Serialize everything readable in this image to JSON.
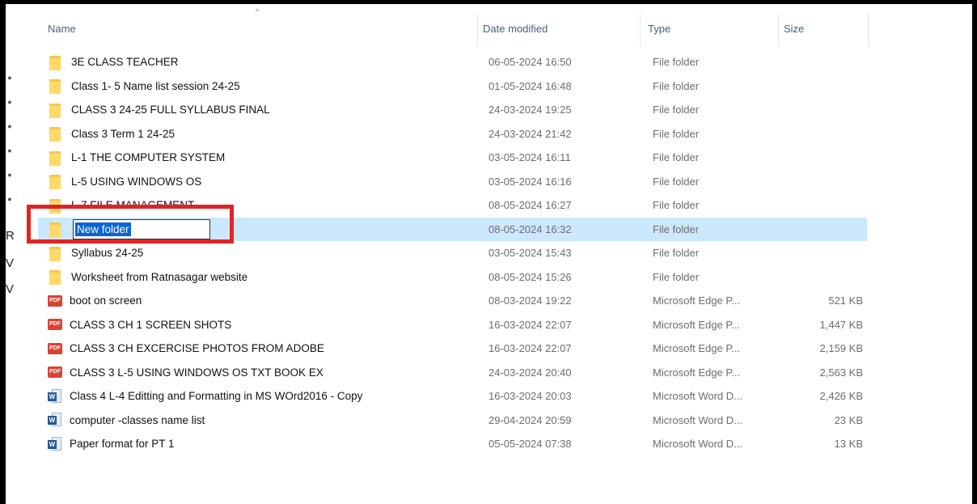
{
  "columns": {
    "name": "Name",
    "date": "Date modified",
    "type": "Type",
    "size": "Size"
  },
  "nav_letters": [
    "R",
    "V",
    "V"
  ],
  "rows": [
    {
      "name": "3E CLASS TEACHER",
      "date": "06-05-2024 16:50",
      "type": "File folder",
      "size": "",
      "icon": "folder-icon"
    },
    {
      "name": "Class 1- 5 Name list session 24-25",
      "date": "01-05-2024 16:48",
      "type": "File folder",
      "size": "",
      "icon": "folder-icon"
    },
    {
      "name": "CLASS 3 24-25 FULL SYLLABUS FINAL",
      "date": "24-03-2024 19:25",
      "type": "File folder",
      "size": "",
      "icon": "folder-icon"
    },
    {
      "name": "Class 3 Term 1 24-25",
      "date": "24-03-2024 21:42",
      "type": "File folder",
      "size": "",
      "icon": "folder-icon"
    },
    {
      "name": "L-1 THE COMPUTER SYSTEM",
      "date": "03-05-2024 16:11",
      "type": "File folder",
      "size": "",
      "icon": "folder-icon"
    },
    {
      "name": "L-5 USING WINDOWS OS",
      "date": "03-05-2024 16:16",
      "type": "File folder",
      "size": "",
      "icon": "folder-icon"
    },
    {
      "name": "L-7 FILE MANAGEMENT",
      "date": "08-05-2024 16:27",
      "type": "File folder",
      "size": "",
      "icon": "folder-icon"
    },
    {
      "name": "New folder",
      "date": "08-05-2024 16:32",
      "type": "File folder",
      "size": "",
      "icon": "folder-icon",
      "renaming": true
    },
    {
      "name": "Syllabus 24-25",
      "date": "03-05-2024 15:43",
      "type": "File folder",
      "size": "",
      "icon": "folder-icon"
    },
    {
      "name": "Worksheet from Ratnasagar website",
      "date": "08-05-2024 15:26",
      "type": "File folder",
      "size": "",
      "icon": "folder-icon"
    },
    {
      "name": "boot on screen",
      "date": "08-03-2024 19:22",
      "type": "Microsoft Edge P...",
      "size": "521 KB",
      "icon": "pdf-icon"
    },
    {
      "name": "CLASS 3 CH 1 SCREEN SHOTS",
      "date": "16-03-2024 22:07",
      "type": "Microsoft Edge P...",
      "size": "1,447 KB",
      "icon": "pdf-icon"
    },
    {
      "name": "CLASS 3 CH EXCERCISE PHOTOS FROM ADOBE",
      "date": "16-03-2024 22:07",
      "type": "Microsoft Edge P...",
      "size": "2,159 KB",
      "icon": "pdf-icon"
    },
    {
      "name": "CLASS 3 L-5 USING WINDOWS OS TXT BOOK EX",
      "date": "24-03-2024 20:40",
      "type": "Microsoft Edge P...",
      "size": "2,563 KB",
      "icon": "pdf-icon"
    },
    {
      "name": "Class 4 L-4 Editting and Formatting in MS WOrd2016 - Copy",
      "date": "16-03-2024 20:03",
      "type": "Microsoft Word D...",
      "size": "2,426 KB",
      "icon": "word-icon"
    },
    {
      "name": "computer -classes name list",
      "date": "29-04-2024 20:59",
      "type": "Microsoft Word D...",
      "size": "23 KB",
      "icon": "word-icon"
    },
    {
      "name": "Paper format for PT 1",
      "date": "05-05-2024 07:38",
      "type": "Microsoft Word D...",
      "size": "13 KB",
      "icon": "word-icon"
    }
  ],
  "pdf_icon_text": "PDF"
}
